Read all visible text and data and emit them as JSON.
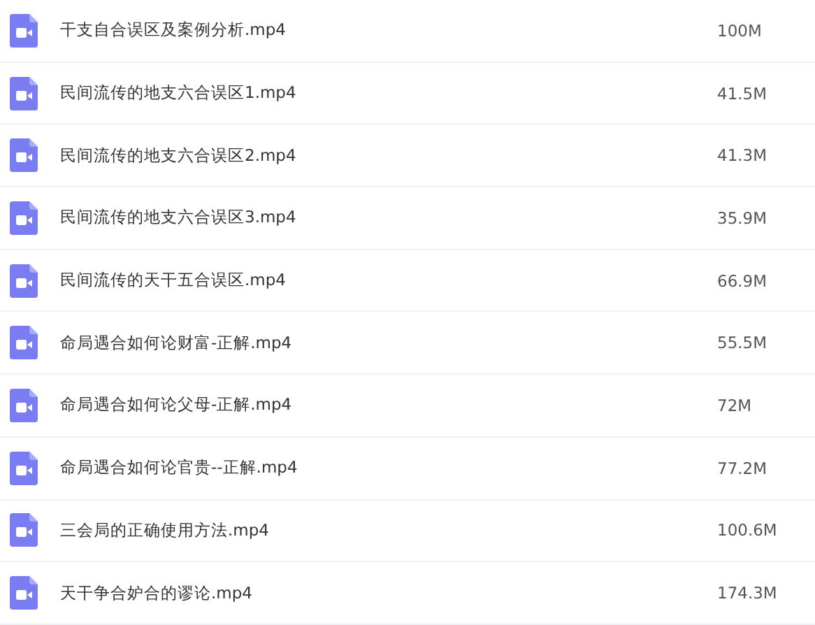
{
  "files": [
    {
      "name": "干支自合误区及案例分析.mp4",
      "size": "100M"
    },
    {
      "name": "民间流传的地支六合误区1.mp4",
      "size": "41.5M"
    },
    {
      "name": "民间流传的地支六合误区2.mp4",
      "size": "41.3M"
    },
    {
      "name": "民间流传的地支六合误区3.mp4",
      "size": "35.9M"
    },
    {
      "name": "民间流传的天干五合误区.mp4",
      "size": "66.9M"
    },
    {
      "name": "命局遇合如何论财富-正解.mp4",
      "size": "55.5M"
    },
    {
      "name": "命局遇合如何论父母-正解.mp4",
      "size": "72M"
    },
    {
      "name": "命局遇合如何论官贵--正解.mp4",
      "size": "77.2M"
    },
    {
      "name": "三会局的正确使用方法.mp4",
      "size": "100.6M"
    },
    {
      "name": "天干争合妒合的谬论.mp4",
      "size": "174.3M"
    }
  ]
}
